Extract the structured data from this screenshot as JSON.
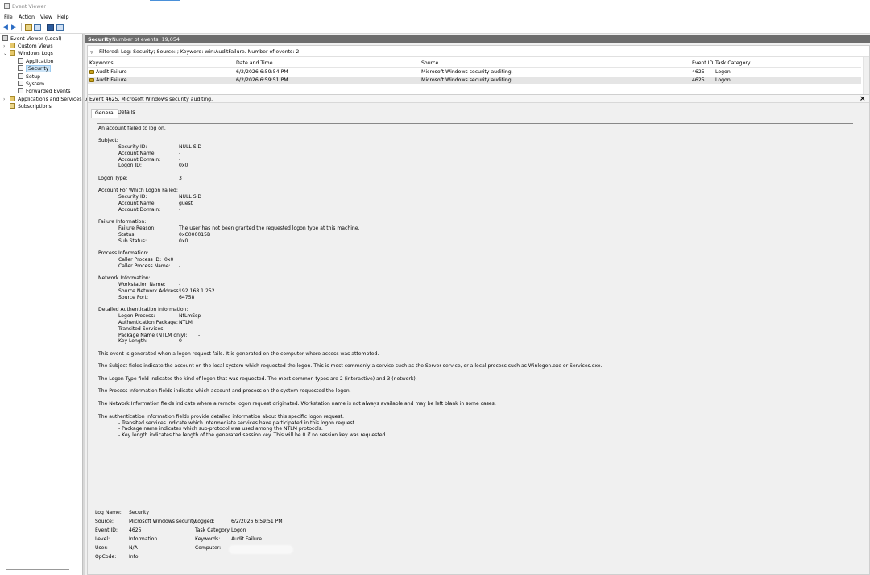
{
  "window": {
    "title": "Event Viewer"
  },
  "menu": {
    "file": "File",
    "action": "Action",
    "view": "View",
    "help": "Help"
  },
  "tree": {
    "root": "Event Viewer (Local)",
    "custom_views": "Custom Views",
    "windows_logs": "Windows Logs",
    "application": "Application",
    "security": "Security",
    "setup": "Setup",
    "system": "System",
    "forwarded": "Forwarded Events",
    "apps_services": "Applications and Services Lo",
    "subscriptions": "Subscriptions"
  },
  "log_header": {
    "name": "Security",
    "count": "Number of events: 19,054"
  },
  "filter": {
    "text": "Filtered: Log: Security; Source: ; Keyword: win:AuditFailure. Number of events: 2"
  },
  "columns": {
    "keywords": "Keywords",
    "date": "Date and Time",
    "source": "Source",
    "event_id": "Event ID",
    "task": "Task Category"
  },
  "events": [
    {
      "keywords": "Audit Failure",
      "date": "6/2/2026 6:59:54 PM",
      "source": "Microsoft Windows security auditing.",
      "event_id": "4625",
      "task": "Logon"
    },
    {
      "keywords": "Audit Failure",
      "date": "6/2/2026 6:59:51 PM",
      "source": "Microsoft Windows security auditing.",
      "event_id": "4625",
      "task": "Logon"
    }
  ],
  "detail": {
    "title": "Event 4625, Microsoft Windows security auditing.",
    "tab_general": "General",
    "tab_details": "Details",
    "lines": {
      "intro": "An account failed to log on.",
      "subject": "Subject:",
      "s_sid_l": "Security ID:",
      "s_sid_v": "NULL SID",
      "s_an_l": "Account Name:",
      "s_an_v": "-",
      "s_ad_l": "Account Domain:",
      "s_ad_v": "-",
      "s_lid_l": "Logon ID:",
      "s_lid_v": "0x0",
      "lt_l": "Logon Type:",
      "lt_v": "3",
      "acct": "Account For Which Logon Failed:",
      "a_sid_l": "Security ID:",
      "a_sid_v": "NULL SID",
      "a_an_l": "Account Name:",
      "a_an_v": "guest",
      "a_ad_l": "Account Domain:",
      "a_ad_v": "-",
      "fail": "Failure Information:",
      "f_r_l": "Failure Reason:",
      "f_r_v": "The user has not been granted the requested logon type at this machine.",
      "f_s_l": "Status:",
      "f_s_v": "0xC000015B",
      "f_ss_l": "Sub Status:",
      "f_ss_v": "0x0",
      "proc": "Process Information:",
      "p_id": "Caller Process ID:  0x0",
      "p_n_l": "Caller Process Name:",
      "p_n_v": "-",
      "net": "Network Information:",
      "n_w_l": "Workstation Name:",
      "n_w_v": "-",
      "n_a_l": "Source Network Address:",
      "n_a_v": "192.168.1.252",
      "n_p_l": "Source Port:",
      "n_p_v": "64758",
      "auth": "Detailed Authentication Information:",
      "d_lp_l": "Logon Process:",
      "d_lp_v": "NtLmSsp",
      "d_ap_l": "Authentication Package:",
      "d_ap_v": "NTLM",
      "d_ts_l": "Transited Services:",
      "d_ts_v": "-",
      "d_pn_l": "Package Name (NTLM only):",
      "d_pn_v": "-",
      "d_kl_l": "Key Length:",
      "d_kl_v": "0",
      "p1": "This event is generated when a logon request fails. It is generated on the computer where access was attempted.",
      "p2": "The Subject fields indicate the account on the local system which requested the logon. This is most commonly a service such as the Server service, or a local process such as Winlogon.exe or Services.exe.",
      "p3": "The Logon Type field indicates the kind of logon that was requested. The most common types are 2 (interactive) and 3 (network).",
      "p4": "The Process Information fields indicate which account and process on the system requested the logon.",
      "p5": "The Network Information fields indicate where a remote logon request originated. Workstation name is not always available and may be left blank in some cases.",
      "p6": "The authentication information fields provide detailed information about this specific logon request.",
      "b1": "- Transited services indicate which intermediate services have participated in this logon request.",
      "b2": "- Package name indicates which sub-protocol was used among the NTLM protocols.",
      "b3": "- Key length indicates the length of the generated session key. This will be 0 if no session key was requested."
    },
    "props": {
      "log_name_l": "Log Name:",
      "log_name_v": "Security",
      "source_l": "Source:",
      "source_v": "Microsoft Windows security",
      "logged_l": "Logged:",
      "logged_v": "6/2/2026 6:59:51 PM",
      "event_id_l": "Event ID:",
      "event_id_v": "4625",
      "task_l": "Task Category:",
      "task_v": "Logon",
      "level_l": "Level:",
      "level_v": "Information",
      "keywords_l": "Keywords:",
      "keywords_v": "Audit Failure",
      "user_l": "User:",
      "user_v": "N/A",
      "computer_l": "Computer:",
      "opcode_l": "OpCode:",
      "opcode_v": "Info"
    }
  }
}
